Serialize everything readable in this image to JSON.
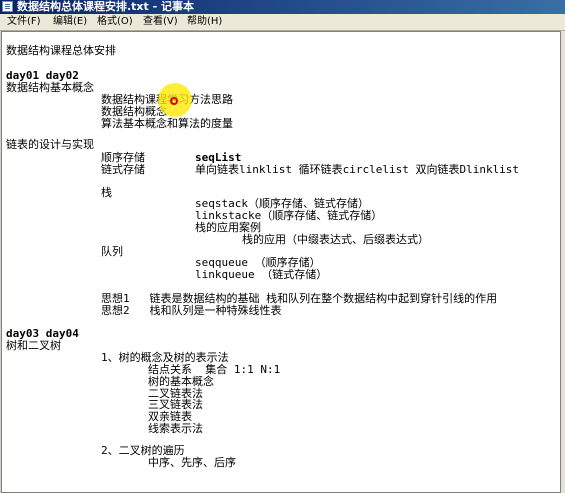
{
  "window": {
    "title": "数据结构总体课程安排.txt - 记事本"
  },
  "menu": [
    {
      "label": "文件(F)"
    },
    {
      "label": "编辑(E)"
    },
    {
      "label": "格式(O)"
    },
    {
      "label": "查看(V)"
    },
    {
      "label": "帮助(H)"
    }
  ],
  "document": {
    "lines": [
      {
        "text": "数据结构课程总体安排"
      },
      {
        "text": "day01 day02",
        "latin": true
      },
      {
        "text": "数据结构基本概念"
      },
      {
        "text": "数据结构课程学习方法思路"
      },
      {
        "text": "数据结构概念"
      },
      {
        "text": "算法基本概念和算法的度量"
      },
      {
        "text": "链表的设计与实现"
      },
      {
        "text": "顺序存储"
      },
      {
        "text": "seqList",
        "latin": true
      },
      {
        "text": "链式存储"
      },
      {
        "text": "单向链表linklist 循环链表circlelist 双向链表Dlinklist"
      },
      {
        "text": "栈"
      },
      {
        "text": "seqstack（顺序存储、链式存储）"
      },
      {
        "text": "linkstacke（顺序存储、链式存储）"
      },
      {
        "text": "栈的应用案例"
      },
      {
        "text": "栈的应用（中缀表达式、后缀表达式）"
      },
      {
        "text": "队列"
      },
      {
        "text": "seqqueue （顺序存储）"
      },
      {
        "text": "linkqueue （链式存储）"
      },
      {
        "text": "思想1   链表是数据结构的基础 栈和队列在整个数据结构中起到穿针引线的作用"
      },
      {
        "text": "思想2   栈和队列是一种特殊线性表"
      },
      {
        "text": "day03 day04",
        "latin": true
      },
      {
        "text": "树和二叉树"
      },
      {
        "text": "1、树的概念及树的表示法"
      },
      {
        "text": "结点关系  集合 1:1 N:1"
      },
      {
        "text": "树的基本概念"
      },
      {
        "text": "二叉链表法"
      },
      {
        "text": "三叉链表法"
      },
      {
        "text": "双亲链表"
      },
      {
        "text": "线索表示法"
      },
      {
        "text": "2、二叉树的遍历"
      },
      {
        "text": "中序、先序、后序"
      }
    ]
  }
}
